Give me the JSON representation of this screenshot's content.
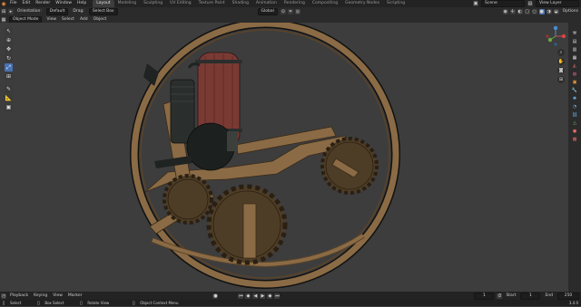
{
  "menu": [
    "File",
    "Edit",
    "Render",
    "Window",
    "Help"
  ],
  "workspaces": [
    "Layout",
    "Modeling",
    "Sculpting",
    "UV Editing",
    "Texture Paint",
    "Shading",
    "Animation",
    "Rendering",
    "Compositing",
    "Geometry Nodes",
    "Scripting"
  ],
  "scene_label": "Scene",
  "view_layer_label": "View Layer",
  "header": {
    "orientation_label": "Orientation:",
    "orientation_value": "Default",
    "drag_label": "Drag:",
    "drag_value": "Select Box",
    "transform_orientation": "Global",
    "options_label": "Options"
  },
  "mode": {
    "mode_value": "Object Mode",
    "view": "View",
    "select": "Select",
    "add": "Add",
    "object": "Object"
  },
  "timeline": {
    "playback": "Playback",
    "keying": "Keying",
    "view": "View",
    "marker": "Marker",
    "current_frame": "1",
    "start_label": "Start",
    "start_value": "1",
    "end_label": "End",
    "end_value": "250"
  },
  "status": {
    "select": "Select",
    "box_select": "Box Select",
    "rotate_view": "Rotate View",
    "context_menu": "Object Context Menu",
    "version": "3.4.0"
  },
  "colors": {
    "wood": "#8a6b45",
    "wood_dark": "#5a4329",
    "gear": "#4e3d26",
    "tank_red": "#7a3a34",
    "engine_dark": "#2a2e2c",
    "accent_blue": "#4772b3"
  }
}
